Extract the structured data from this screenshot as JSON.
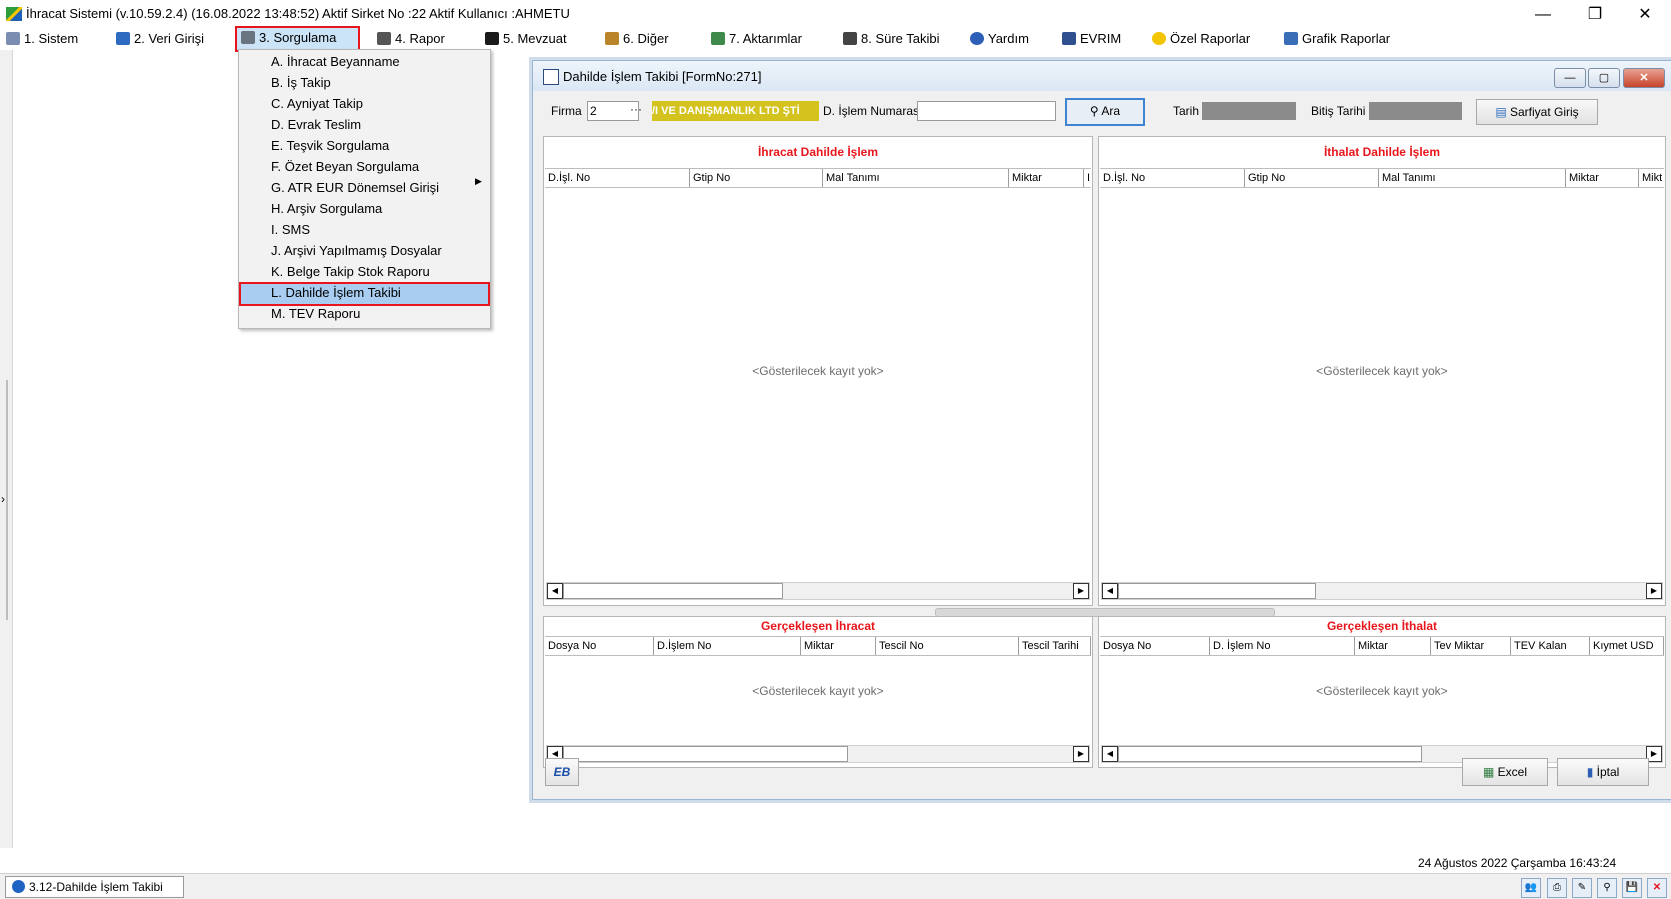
{
  "window": {
    "title": "İhracat Sistemi (v.10.59.2.4) (16.08.2022 13:48:52) Aktif Sirket No :22 Aktif Kullanıcı :AHMETU",
    "minimize": "—",
    "restore": "❐",
    "close": "✕"
  },
  "menu": [
    {
      "label": "1.  Sistem",
      "icon": "system-icon"
    },
    {
      "label": "2.  Veri Girişi",
      "icon": "data-entry-icon"
    },
    {
      "label": "3.  Sorgulama",
      "icon": "query-icon"
    },
    {
      "label": "4.  Rapor",
      "icon": "printer-icon"
    },
    {
      "label": "5.  Mevzuat",
      "icon": "book-icon"
    },
    {
      "label": "6.  Diğer",
      "icon": "tools-icon"
    },
    {
      "label": "7.  Aktarımlar",
      "icon": "transfer-icon"
    },
    {
      "label": "8. Süre Takibi",
      "icon": "clock-icon"
    },
    {
      "label": "Yardım",
      "icon": "help-icon"
    },
    {
      "label": "EVRIM",
      "icon": "evrim-icon"
    },
    {
      "label": "Özel Raporlar",
      "icon": "star-icon"
    },
    {
      "label": "Grafik Raporlar",
      "icon": "chart-icon"
    }
  ],
  "dropdown": [
    "A.  İhracat Beyanname",
    "B.  İş Takip",
    "C.  Ayniyat Takip",
    "D.  Evrak Teslim",
    "E.  Teşvik Sorgulama",
    "F.  Özet Beyan Sorgulama",
    "G.  ATR EUR Dönemsel Girişi",
    "H.  Arşiv Sorgulama",
    "I.  SMS",
    "J.  Arşivi Yapılmamış Dosyalar",
    "K.  Belge Takip Stok Raporu",
    "L. Dahilde İşlem Takibi",
    "M. TEV Raporu"
  ],
  "form": {
    "title": "Dahilde İşlem Takibi [FormNo:271]",
    "firma_label": "Firma",
    "firma_value": "2",
    "firma_dots": "···",
    "firma_name": "/I VE DANIŞMANLIK LTD ŞTİ",
    "islem_label": "D. İşlem Numaras",
    "islem_value": "",
    "ara_label": "Ara",
    "tarih_label": "Tarih",
    "bitis_label": "Bitiş Tarihi",
    "sarfiyat_label": "Sarfiyat Giriş",
    "excel_label": "Excel",
    "iptal_label": "İptal",
    "eb_label": "EB"
  },
  "panels": {
    "ihracat": {
      "title": "İhracat Dahilde İşlem",
      "columns": [
        "D.İşl. No",
        "Gtip No",
        "Mal Tanımı",
        "Miktar",
        "I"
      ],
      "empty": "<Gösterilecek kayıt yok>"
    },
    "ithalat": {
      "title": "İthalat Dahilde İşlem",
      "columns": [
        "D.İşl. No",
        "Gtip No",
        "Mal Tanımı",
        "Miktar",
        "Mikt"
      ],
      "empty": "<Gösterilecek kayıt yok>"
    },
    "g_ihracat": {
      "title": "Gerçekleşen İhracat",
      "columns": [
        "Dosya No",
        "D.İşlem No",
        "Miktar",
        "Tescil No",
        "Tescil Tarihi"
      ],
      "empty": "<Gösterilecek kayıt yok>"
    },
    "g_ithalat": {
      "title": "Gerçekleşen İthalat",
      "columns": [
        "Dosya No",
        "D. İşlem No",
        "Miktar",
        "Tev Miktar",
        "TEV Kalan",
        "Kıymet USD"
      ],
      "empty": "<Gösterilecek kayıt yok>"
    }
  },
  "status": {
    "datetime": "24 Ağustos 2022 Çarşamba 16:43:24",
    "task": "3.12-Dahilde İşlem Takibi"
  },
  "colors": {
    "highlight_border": "#e8161c",
    "panel_title": "#e8161c",
    "firma_badge": "#d4c21f",
    "selected_item": "#a9cdf0"
  }
}
